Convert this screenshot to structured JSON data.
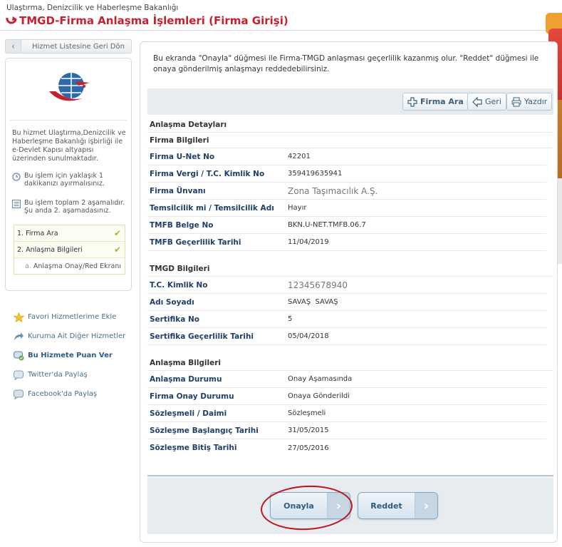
{
  "header": {
    "ministry": "Ulaştırma, Denizcilik ve Haberleşme Bakanlığı",
    "title": "TMGD-Firma Anlaşma İşlemleri (Firma Girişi)"
  },
  "sidebar": {
    "back_label": "Hizmet Listesine Geri Dön",
    "description": "Bu hizmet Ulaştırma,Denizcilik ve Haberleşme Bakanlığı işbirliği ile e-Devlet Kapısı altyapısı üzerinden sunulmaktadır.",
    "time_info": "Bu işlem için yaklaşık 1 dakikanızı ayırmalısınız.",
    "step_info": "Bu işlem toplam 2 aşamalıdır. Şu anda 2. aşamadasınız.",
    "steps": [
      {
        "label": "1. Firma Ara",
        "done": true
      },
      {
        "label": "2. Anlaşma Bilgileri",
        "done": true
      }
    ],
    "substep_prefix": "a.",
    "substep_label": "Anlaşma Onay/Red Ekranı",
    "links": [
      {
        "label": "Favori Hizmetlerime Ekle",
        "icon": "star-icon"
      },
      {
        "label": "Kuruma Ait Diğer Hizmetler",
        "icon": "arrow-icon"
      },
      {
        "label": "Bu Hizmete Puan Ver",
        "icon": "rating-icon"
      },
      {
        "label": "Twitter'da Paylaş",
        "icon": "twitter-icon"
      },
      {
        "label": "Facebook'da Paylaş",
        "icon": "facebook-icon"
      }
    ]
  },
  "main": {
    "info": "Bu ekranda \"Onayla\" düğmesi ile Firma-TMGD anlaşması geçerlilik kazanmış olur. \"Reddet\" düğmesi ile onaya gönderilmiş anlaşmayı reddedebilirsiniz.",
    "toolbar": {
      "search_label": "Firma Ara",
      "back_label": "Geri",
      "print_label": "Yazdır"
    },
    "details_title": "Anlaşma Detayları",
    "firma": {
      "title": "Firma Bilgileri",
      "rows": [
        {
          "label": "Firma U-Net No",
          "value": "42201"
        },
        {
          "label": "Firma Vergi / T.C. Kimlik No",
          "value": "359419635941"
        },
        {
          "label": "Firma Ünvanı",
          "value": "Zona Taşımacılık A.Ş."
        },
        {
          "label": "Temsilcilik mi / Temsilcilik Adı",
          "value": "Hayır"
        },
        {
          "label": "TMFB Belge No",
          "value": "BKN.U-NET.TMFB.06.7"
        },
        {
          "label": "TMFB Geçerlilik Tarihi",
          "value": "11/04/2019"
        }
      ]
    },
    "tmgd": {
      "title": "TMGD Bilgileri",
      "rows": [
        {
          "label": "T.C. Kimlik No",
          "value": "12345678940"
        },
        {
          "label": "Adı Soyadı",
          "value": "SAVAŞ  SAVAŞ"
        },
        {
          "label": "Sertifika No",
          "value": "5"
        },
        {
          "label": "Sertifika Geçerlilik Tarihi",
          "value": "05/04/2018"
        }
      ]
    },
    "anlasma": {
      "title": "Anlaşma Bilgileri",
      "rows": [
        {
          "label": "Anlaşma Durumu",
          "value": "Onay Aşamasında"
        },
        {
          "label": "Firma Onay Durumu",
          "value": "Onaya Gönderildi"
        },
        {
          "label": "Sözleşmeli / Daimi",
          "value": "Sözleşmeli"
        },
        {
          "label": "Sözleşme Başlangıç Tarihi",
          "value": "31/05/2015"
        },
        {
          "label": "Sözleşme Bitiş Tarihi",
          "value": "27/05/2016"
        }
      ]
    },
    "actions": {
      "approve_label": "Onayla",
      "reject_label": "Reddet"
    }
  },
  "colors": {
    "brand_red": "#c8202d",
    "link_blue": "#2d5b82",
    "label_navy": "#1f3f6b",
    "highlight_oval": "#c0141c",
    "step_check": "#8fbf3a"
  }
}
